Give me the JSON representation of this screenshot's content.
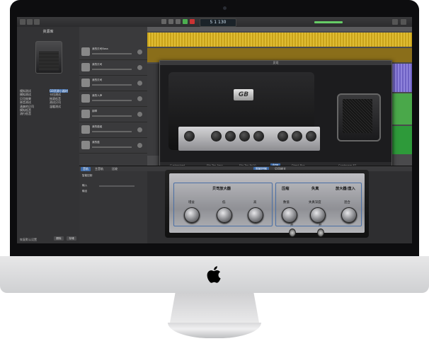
{
  "window": {
    "lcd_bar": "5 1",
    "lcd_tempo": "130"
  },
  "library": {
    "title": "资源库",
    "col1": [
      "模拟测试",
      "模拟测试",
      "贝司效果",
      "原音测试",
      "清爽的贝司",
      "模拟低音",
      "流行低音"
    ],
    "col2": [
      "GB资源小器材",
      "卡拉测试",
      "摇滚低音",
      "测试贝司",
      "温暖测试"
    ],
    "footer_label": "恢复默认设置",
    "btn_delete": "删除",
    "btn_save": "存储"
  },
  "tracks": [
    "我的贝司Bass",
    "我的贝司",
    "我的贝司",
    "我的人声",
    "钢琴",
    "我的鼓组",
    "我的鼓"
  ],
  "plugin": {
    "window_title": "贝司",
    "brand": "GB",
    "name": "Bass Amp Designer",
    "footer": [
      "Customized",
      "Flip-Top Amp",
      "Flip-Top 8x10",
      "Amp",
      "Direct Box",
      "Condenser 87"
    ]
  },
  "lower": {
    "tabs": [
      "音轨",
      "主音轨",
      "比较",
      "智能控制",
      "贝司放大"
    ],
    "side_items": [
      "智能控制",
      "输入",
      "输出"
    ]
  },
  "ampface": {
    "section_left_title": "贝司放大器",
    "section_right_titles": [
      "压缩",
      "失真",
      "放大器/直入"
    ],
    "knob_labels": [
      "增益",
      "低",
      "高",
      "数值",
      "失真深度",
      "混合"
    ],
    "switch_labels": [
      "开",
      "开"
    ]
  },
  "colors": {
    "bezel": "#0d0d0f",
    "chin": "#dcdcdd",
    "accent": "#3d6aa8"
  }
}
